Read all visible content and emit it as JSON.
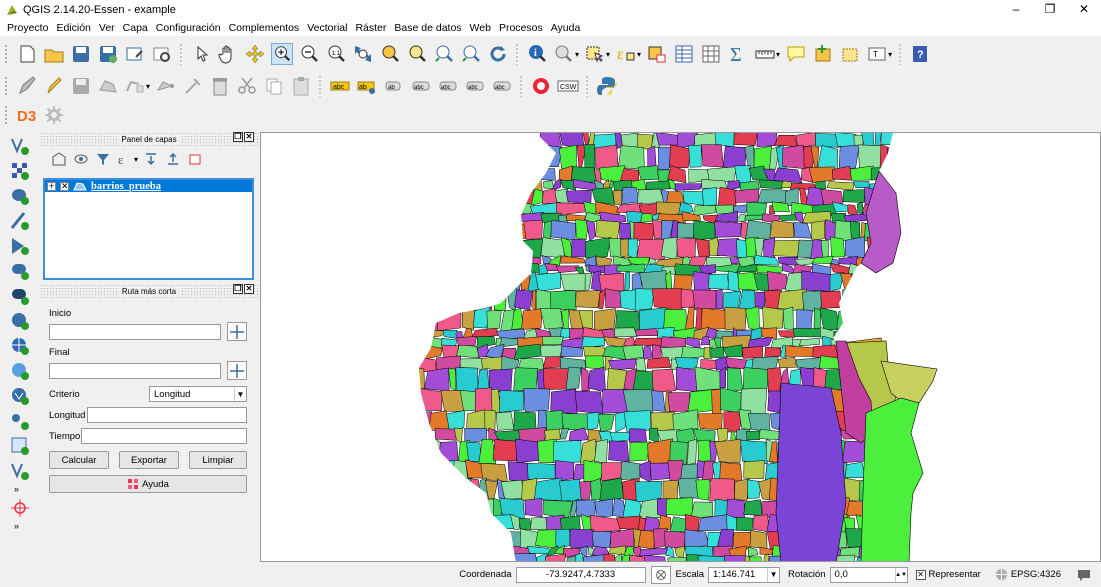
{
  "window": {
    "title": "QGIS 2.14.20-Essen - example",
    "min": "–",
    "max": "❐",
    "close": "✕"
  },
  "menu": [
    "Proyecto",
    "Edición",
    "Ver",
    "Capa",
    "Configuración",
    "Complementos",
    "Vectorial",
    "Ráster",
    "Base de datos",
    "Web",
    "Procesos",
    "Ayuda"
  ],
  "toolbar1": [
    "new-project",
    "open-project",
    "save-project",
    "save-as",
    "print-composer",
    "composer-manager",
    "pan-to-selection",
    "pan-map",
    "pan-map-icon",
    "zoom-in",
    "zoom-out",
    "zoom-native",
    "zoom-full",
    "zoom-layer",
    "zoom-selection",
    "zoom-last",
    "zoom-next",
    "refresh",
    "identify",
    "measure",
    "select-features",
    "deselect",
    "open-attribute-table",
    "statistics",
    "sum",
    "measure-line",
    "annotation",
    "new-bookmark",
    "show-bookmarks",
    "text-annotation",
    "help"
  ],
  "toolbar2": [
    "current-edits",
    "toggle-editing",
    "save-edits",
    "add-feature",
    "vertex-tool",
    "delete-selected",
    "cut-features",
    "copy-features",
    "paste-features",
    "label-tool",
    "pin-labels",
    "show-hide-labels",
    "move-label",
    "rotate-label",
    "change-label",
    "csw",
    "python"
  ],
  "toolbar3": [
    "d3",
    "settings"
  ],
  "layers_panel": {
    "title": "Panel de capas",
    "layer_name": "barrios_prueba"
  },
  "route_panel": {
    "title": "Ruta más corta",
    "inicio_label": "Inicio",
    "inicio_value": "",
    "final_label": "Final",
    "final_value": "",
    "criterio_label": "Criterio",
    "criterio_value": "Longitud",
    "longitud_label": "Longitud",
    "tiempo_label": "Tiempo",
    "calcular": "Calcular",
    "exportar": "Exportar",
    "limpiar": "Limpiar",
    "ayuda": "Ayuda"
  },
  "status": {
    "coord_label": "Coordenada",
    "coord_value": "-73.9247,4.7333",
    "scale_label": "Escala",
    "scale_value": "1:146.741",
    "rotation_label": "Rotación",
    "rotation_value": "0,0",
    "render_label": "Representar",
    "crs": "EPSG:4326"
  },
  "colors": {
    "selection": "#0078d7",
    "accent_blue": "#3c8ed8"
  }
}
